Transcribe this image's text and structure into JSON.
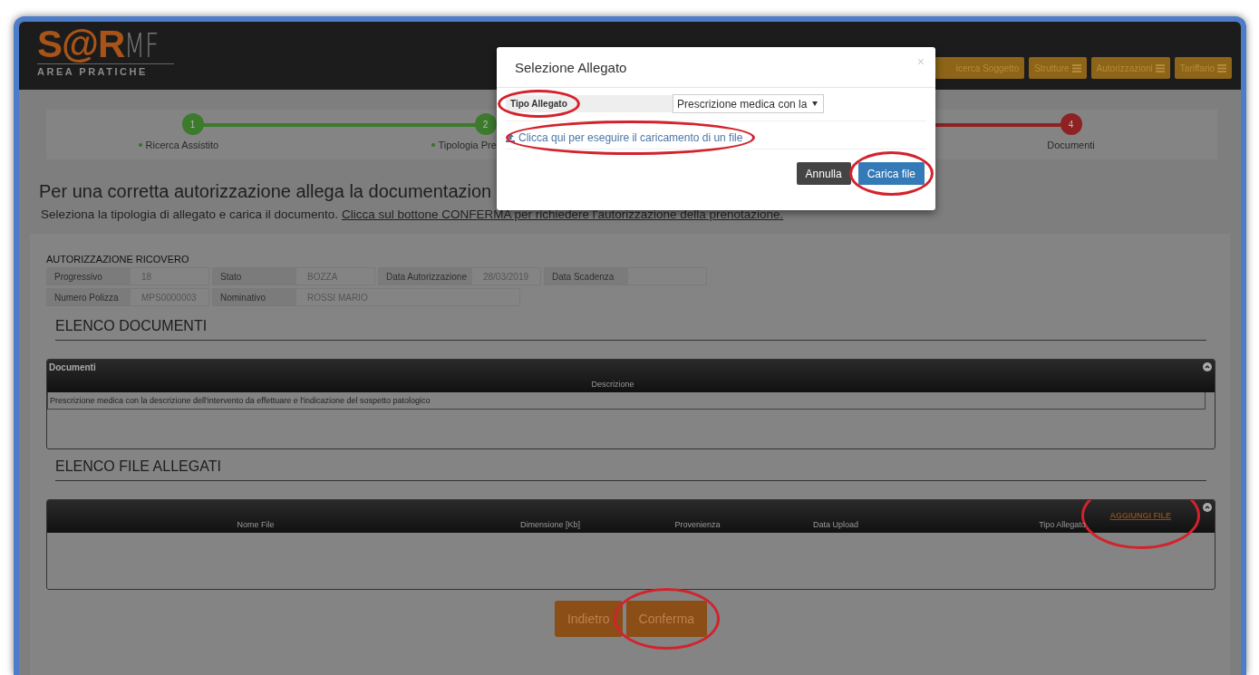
{
  "header": {
    "logo": {
      "brand": "S@R",
      "suffix": "MF",
      "subtitle": "AREA PRATICHE"
    },
    "nav": [
      {
        "label": "icerca Soggetto",
        "menu": false
      },
      {
        "label": "Strutture",
        "menu": true
      },
      {
        "label": "Autorizzazioni",
        "menu": true
      },
      {
        "label": "Tariffario",
        "menu": true
      }
    ]
  },
  "stepper": [
    {
      "number": "1",
      "label": "Ricerca Assistito",
      "completed": true
    },
    {
      "number": "2",
      "label": "Tipologia Pre",
      "completed": true
    },
    {
      "number": "4",
      "label": "Documenti",
      "completed": false
    }
  ],
  "heading": "Per una corretta autorizzazione allega la documentazion",
  "instructions": {
    "text": "Seleziona la tipologia di allegato e carica il documento.",
    "link": "Clicca sul bottone CONFERMA per richiedere l'autorizzazione della prenotazione."
  },
  "authorization": {
    "title": "AUTORIZZAZIONE RICOVERO",
    "rows": [
      [
        {
          "label": "Progressivo",
          "value": "18"
        },
        {
          "label": "Stato",
          "value": "BOZZA"
        },
        {
          "label": "Data Autorizzazione",
          "value": "28/03/2019"
        },
        {
          "label": "Data Scadenza"
        }
      ],
      [
        {
          "label": "Numero Polizza",
          "value": "MPS0000003"
        },
        {
          "label": "Nominativo",
          "value": "ROSSI MARIO"
        }
      ]
    ]
  },
  "documents": {
    "section": "ELENCO DOCUMENTI",
    "caption": "Documenti",
    "columns": [
      "Descrizione"
    ],
    "rows": [
      [
        "Prescrizione medica con la descrizione dell'intervento da effettuare e l'indicazione del sospetto patologico"
      ]
    ]
  },
  "files": {
    "section": "ELENCO FILE ALLEGATI",
    "add_link": "AGGIUNGI FILE",
    "columns": [
      "Nome File",
      "Dimensione [Kb]",
      "Provenienza",
      "Data Upload",
      "Tipo Allegato"
    ]
  },
  "buttons": [
    "Indietro",
    "Conferma"
  ],
  "modal": {
    "title": "Selezione Allegato",
    "close": "×",
    "field_label": "Tipo Allegato",
    "select_value": "Prescrizione medica con la",
    "upload_link": "Clicca qui per eseguire il caricamento di un file",
    "buttons": [
      {
        "label": "Annulla",
        "kind": "secondary"
      },
      {
        "label": "Carica file",
        "kind": "primary"
      }
    ]
  }
}
